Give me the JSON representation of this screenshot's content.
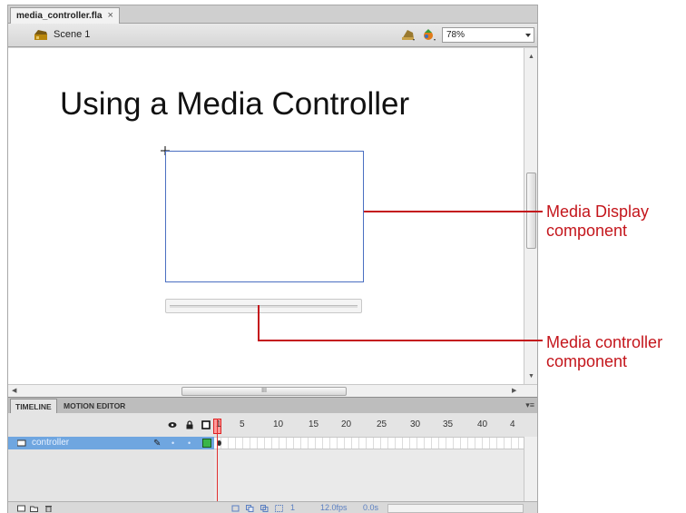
{
  "document_tab": {
    "title": "media_controller.fla",
    "close": "×"
  },
  "edit_bar": {
    "scene_label": "Scene 1",
    "zoom": "78%"
  },
  "stage": {
    "title": "Using a Media Controller"
  },
  "hscroll": {
    "thumb_grip": "III"
  },
  "timeline": {
    "tabs": [
      "TIMELINE",
      "MOTION EDITOR"
    ],
    "frame_numbers": [
      "1",
      "5",
      "10",
      "15",
      "20",
      "25",
      "30",
      "35",
      "40",
      "4"
    ],
    "layer": {
      "name": "controller"
    },
    "footer": {
      "current_frame": "1",
      "fps": "12.0fps",
      "time": "0.0s"
    }
  },
  "callouts": {
    "media_display": [
      "Media Display",
      "component"
    ],
    "media_controller": [
      "Media controller",
      "component"
    ]
  },
  "colors": {
    "callout": "#c4161c",
    "selected_layer": "#6fa6e0",
    "playhead": "#e03030"
  },
  "icons": [
    "scene-icon",
    "edit-symbols-icon",
    "edit-scene-icon",
    "eye-icon",
    "lock-icon",
    "outline-icon",
    "layer-icon",
    "pencil-icon",
    "new-layer-icon",
    "new-folder-icon",
    "trash-icon"
  ]
}
